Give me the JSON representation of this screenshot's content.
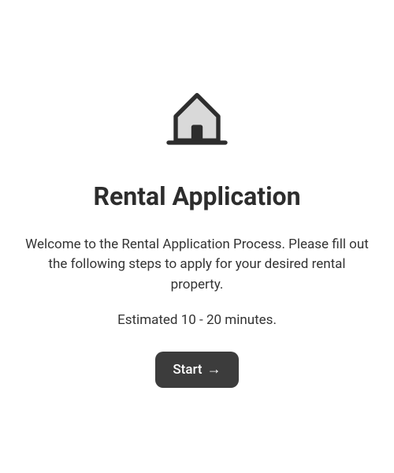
{
  "icon": "house-icon",
  "title": "Rental Application",
  "description": "Welcome to the Rental Application Process. Please fill out the following steps to apply for your desired rental property.",
  "estimate": "Estimated 10 - 20 minutes.",
  "button": {
    "label": "Start",
    "arrow": "→"
  },
  "colors": {
    "text_dark": "#2d2d2d",
    "text_body": "#333333",
    "button_bg": "#3c3c3c",
    "button_text": "#ffffff"
  }
}
